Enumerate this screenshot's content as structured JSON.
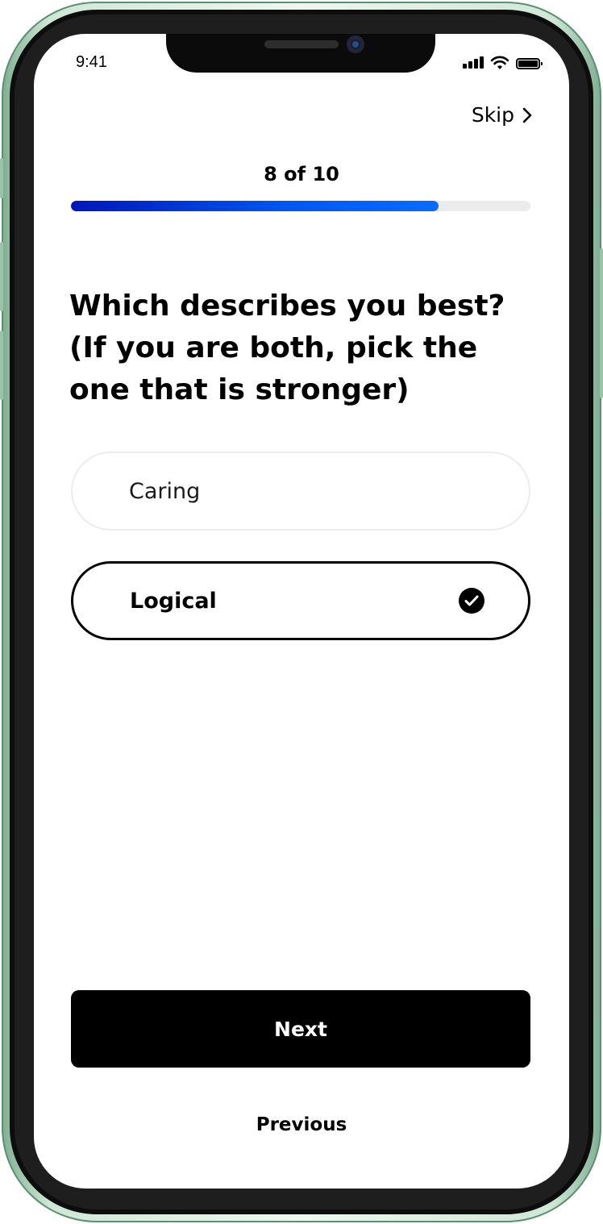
{
  "status_bar": {
    "time": "9:41",
    "signal_icon": "cellular-signal-icon",
    "wifi_icon": "wifi-icon",
    "battery_icon": "battery-icon"
  },
  "header": {
    "skip_label": "Skip",
    "skip_icon": "chevron-right-icon"
  },
  "progress": {
    "label": "8 of 10",
    "current": 8,
    "total": 10,
    "fill_fraction": 0.8
  },
  "question": {
    "text": "Which describes you best? (If you are both, pick the one that is stronger)"
  },
  "options": [
    {
      "label": "Caring",
      "selected": false
    },
    {
      "label": "Logical",
      "selected": true,
      "selected_icon": "checkmark-circle-icon"
    }
  ],
  "footer": {
    "next_label": "Next",
    "previous_label": "Previous"
  },
  "colors": {
    "progress_start": "#0017b8",
    "progress_end": "#0a6bff",
    "primary_button": "#000000",
    "frame_accent": "#9cc3aa"
  }
}
